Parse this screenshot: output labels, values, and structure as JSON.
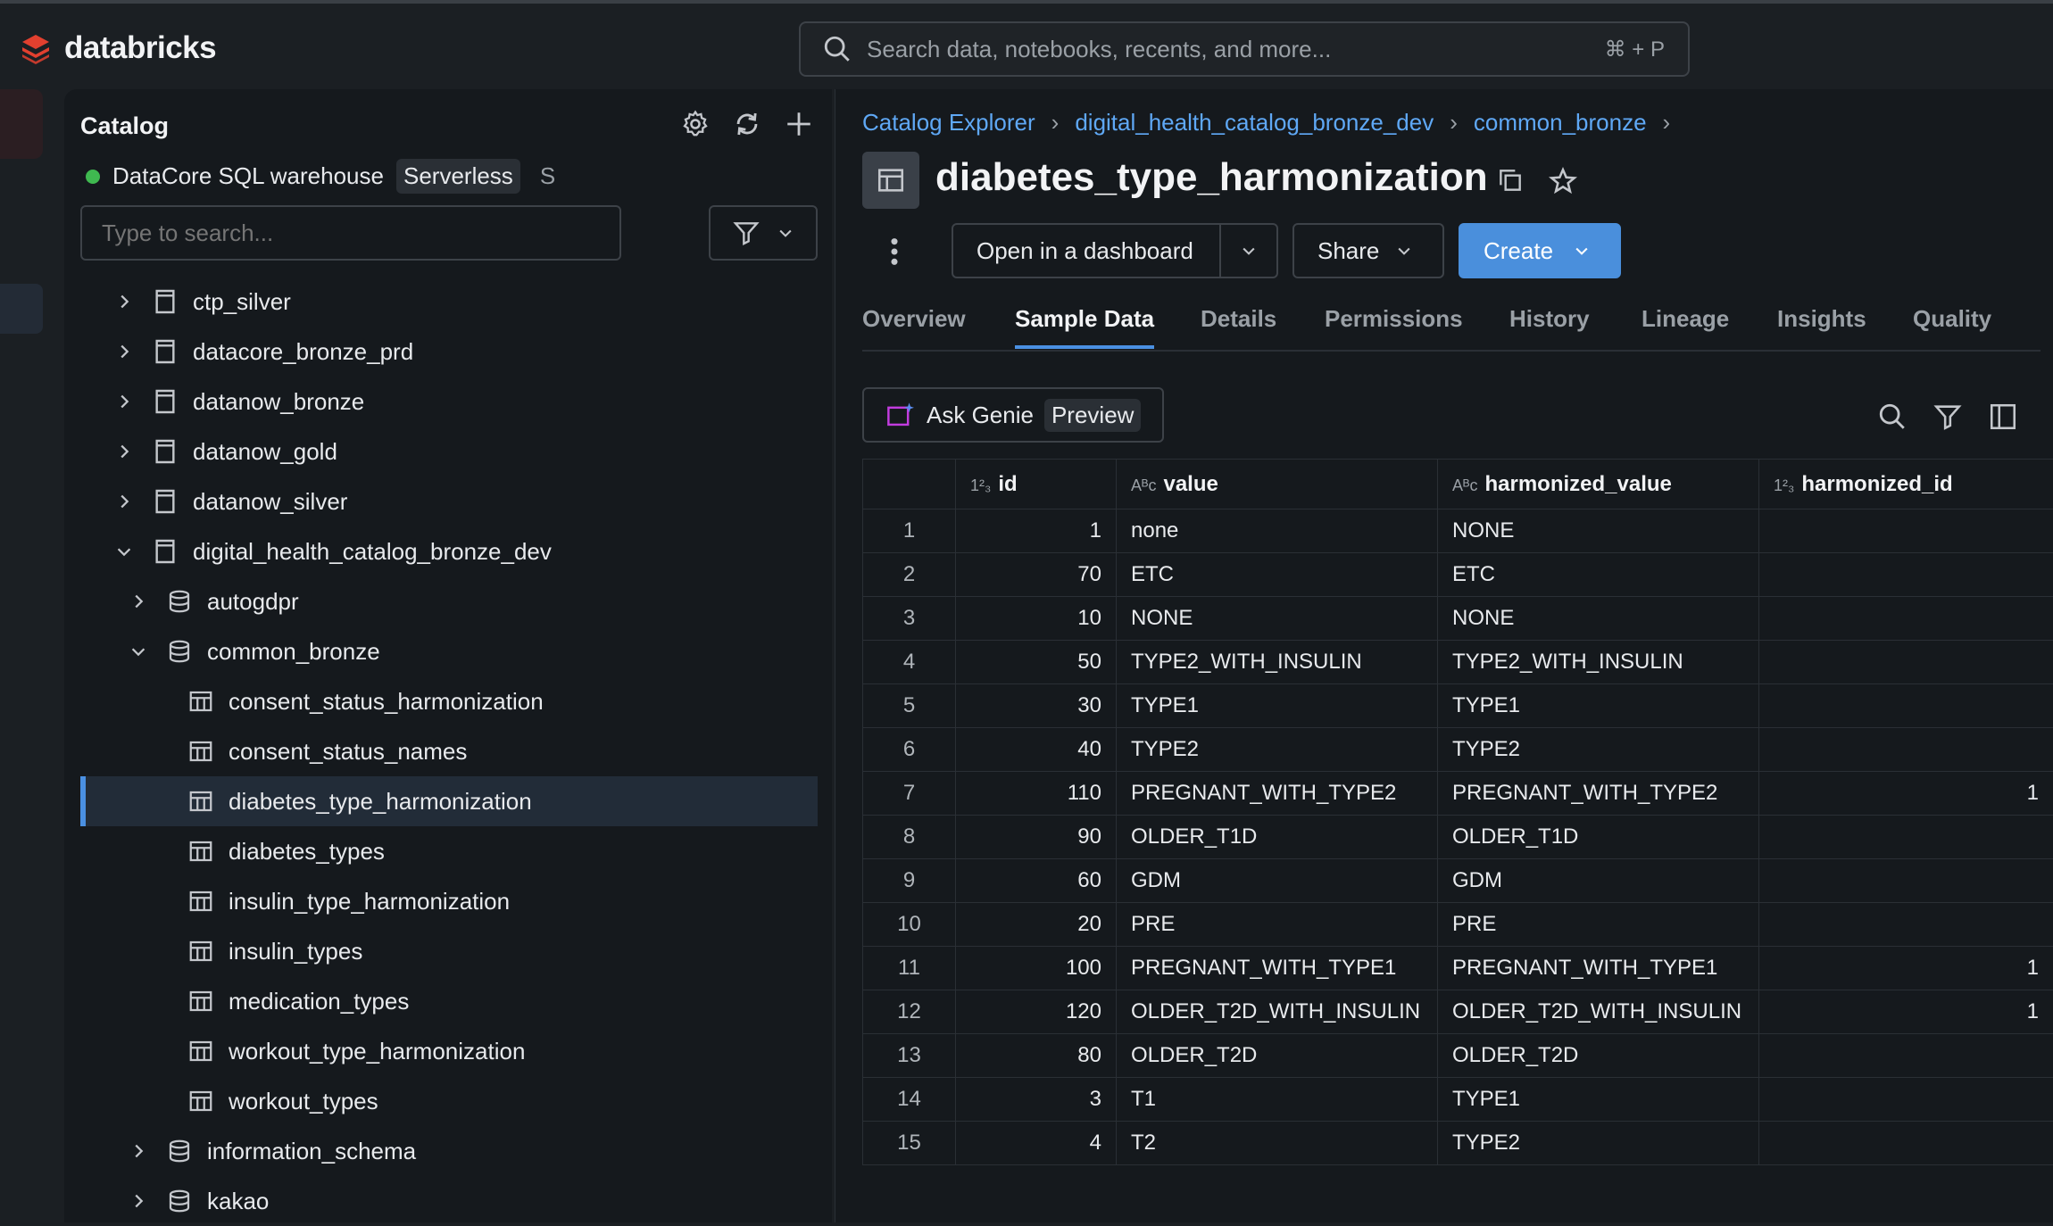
{
  "app": {
    "name": "databricks"
  },
  "search": {
    "placeholder": "Search data, notebooks, recents, and more...",
    "shortcut": "⌘ + P"
  },
  "sidebar": {
    "title": "Catalog",
    "warehouse": {
      "name": "DataCore SQL warehouse",
      "type": "Serverless",
      "size": "S"
    },
    "search_placeholder": "Type to search...",
    "tree": [
      {
        "label": "ctp_silver",
        "kind": "catalog",
        "level": 0,
        "expanded": false
      },
      {
        "label": "datacore_bronze_prd",
        "kind": "catalog",
        "level": 0,
        "expanded": false
      },
      {
        "label": "datanow_bronze",
        "kind": "catalog",
        "level": 0,
        "expanded": false
      },
      {
        "label": "datanow_gold",
        "kind": "catalog",
        "level": 0,
        "expanded": false
      },
      {
        "label": "datanow_silver",
        "kind": "catalog",
        "level": 0,
        "expanded": false
      },
      {
        "label": "digital_health_catalog_bronze_dev",
        "kind": "catalog",
        "level": 0,
        "expanded": true
      },
      {
        "label": "autogdpr",
        "kind": "schema",
        "level": 1,
        "expanded": false
      },
      {
        "label": "common_bronze",
        "kind": "schema",
        "level": 1,
        "expanded": true
      },
      {
        "label": "consent_status_harmonization",
        "kind": "table",
        "level": 2
      },
      {
        "label": "consent_status_names",
        "kind": "table",
        "level": 2
      },
      {
        "label": "diabetes_type_harmonization",
        "kind": "table",
        "level": 2,
        "selected": true
      },
      {
        "label": "diabetes_types",
        "kind": "table",
        "level": 2
      },
      {
        "label": "insulin_type_harmonization",
        "kind": "table",
        "level": 2
      },
      {
        "label": "insulin_types",
        "kind": "table",
        "level": 2
      },
      {
        "label": "medication_types",
        "kind": "table",
        "level": 2
      },
      {
        "label": "workout_type_harmonization",
        "kind": "table",
        "level": 2
      },
      {
        "label": "workout_types",
        "kind": "table",
        "level": 2
      },
      {
        "label": "information_schema",
        "kind": "schema",
        "level": 1,
        "expanded": false
      },
      {
        "label": "kakao",
        "kind": "schema",
        "level": 1,
        "expanded": false
      }
    ]
  },
  "main": {
    "breadcrumb": [
      "Catalog Explorer",
      "digital_health_catalog_bronze_dev",
      "common_bronze"
    ],
    "title": "diabetes_type_harmonization",
    "actions": {
      "dashboard": "Open in a dashboard",
      "share": "Share",
      "create": "Create"
    },
    "tabs": [
      {
        "label": "Overview"
      },
      {
        "label": "Sample Data",
        "active": true
      },
      {
        "label": "Details"
      },
      {
        "label": "Permissions"
      },
      {
        "label": "History"
      },
      {
        "label": "Lineage"
      },
      {
        "label": "Insights"
      },
      {
        "label": "Quality"
      }
    ],
    "genie": {
      "label": "Ask Genie",
      "badge": "Preview"
    },
    "table": {
      "columns": [
        {
          "name": "id",
          "type_icon": "1²₃"
        },
        {
          "name": "value",
          "type_icon": "Aᴮc"
        },
        {
          "name": "harmonized_value",
          "type_icon": "Aᴮc"
        },
        {
          "name": "harmonized_id",
          "type_icon": "1²₃"
        }
      ],
      "rows": [
        {
          "n": "1",
          "id": "1",
          "value": "none",
          "harmonized_value": "NONE",
          "harmonized_id": ""
        },
        {
          "n": "2",
          "id": "70",
          "value": "ETC",
          "harmonized_value": "ETC",
          "harmonized_id": ""
        },
        {
          "n": "3",
          "id": "10",
          "value": "NONE",
          "harmonized_value": "NONE",
          "harmonized_id": ""
        },
        {
          "n": "4",
          "id": "50",
          "value": "TYPE2_WITH_INSULIN",
          "harmonized_value": "TYPE2_WITH_INSULIN",
          "harmonized_id": ""
        },
        {
          "n": "5",
          "id": "30",
          "value": "TYPE1",
          "harmonized_value": "TYPE1",
          "harmonized_id": ""
        },
        {
          "n": "6",
          "id": "40",
          "value": "TYPE2",
          "harmonized_value": "TYPE2",
          "harmonized_id": ""
        },
        {
          "n": "7",
          "id": "110",
          "value": "PREGNANT_WITH_TYPE2",
          "harmonized_value": "PREGNANT_WITH_TYPE2",
          "harmonized_id": "1"
        },
        {
          "n": "8",
          "id": "90",
          "value": "OLDER_T1D",
          "harmonized_value": "OLDER_T1D",
          "harmonized_id": ""
        },
        {
          "n": "9",
          "id": "60",
          "value": "GDM",
          "harmonized_value": "GDM",
          "harmonized_id": ""
        },
        {
          "n": "10",
          "id": "20",
          "value": "PRE",
          "harmonized_value": "PRE",
          "harmonized_id": ""
        },
        {
          "n": "11",
          "id": "100",
          "value": "PREGNANT_WITH_TYPE1",
          "harmonized_value": "PREGNANT_WITH_TYPE1",
          "harmonized_id": "1"
        },
        {
          "n": "12",
          "id": "120",
          "value": "OLDER_T2D_WITH_INSULIN",
          "harmonized_value": "OLDER_T2D_WITH_INSULIN",
          "harmonized_id": "1"
        },
        {
          "n": "13",
          "id": "80",
          "value": "OLDER_T2D",
          "harmonized_value": "OLDER_T2D",
          "harmonized_id": ""
        },
        {
          "n": "14",
          "id": "3",
          "value": "T1",
          "harmonized_value": "TYPE1",
          "harmonized_id": ""
        },
        {
          "n": "15",
          "id": "4",
          "value": "T2",
          "harmonized_value": "TYPE2",
          "harmonized_id": ""
        }
      ]
    }
  },
  "colors": {
    "accent": "#4a90e2",
    "primary_button": "#4a8fdc",
    "brand": "#e2402f",
    "status_green": "#3fb950"
  }
}
